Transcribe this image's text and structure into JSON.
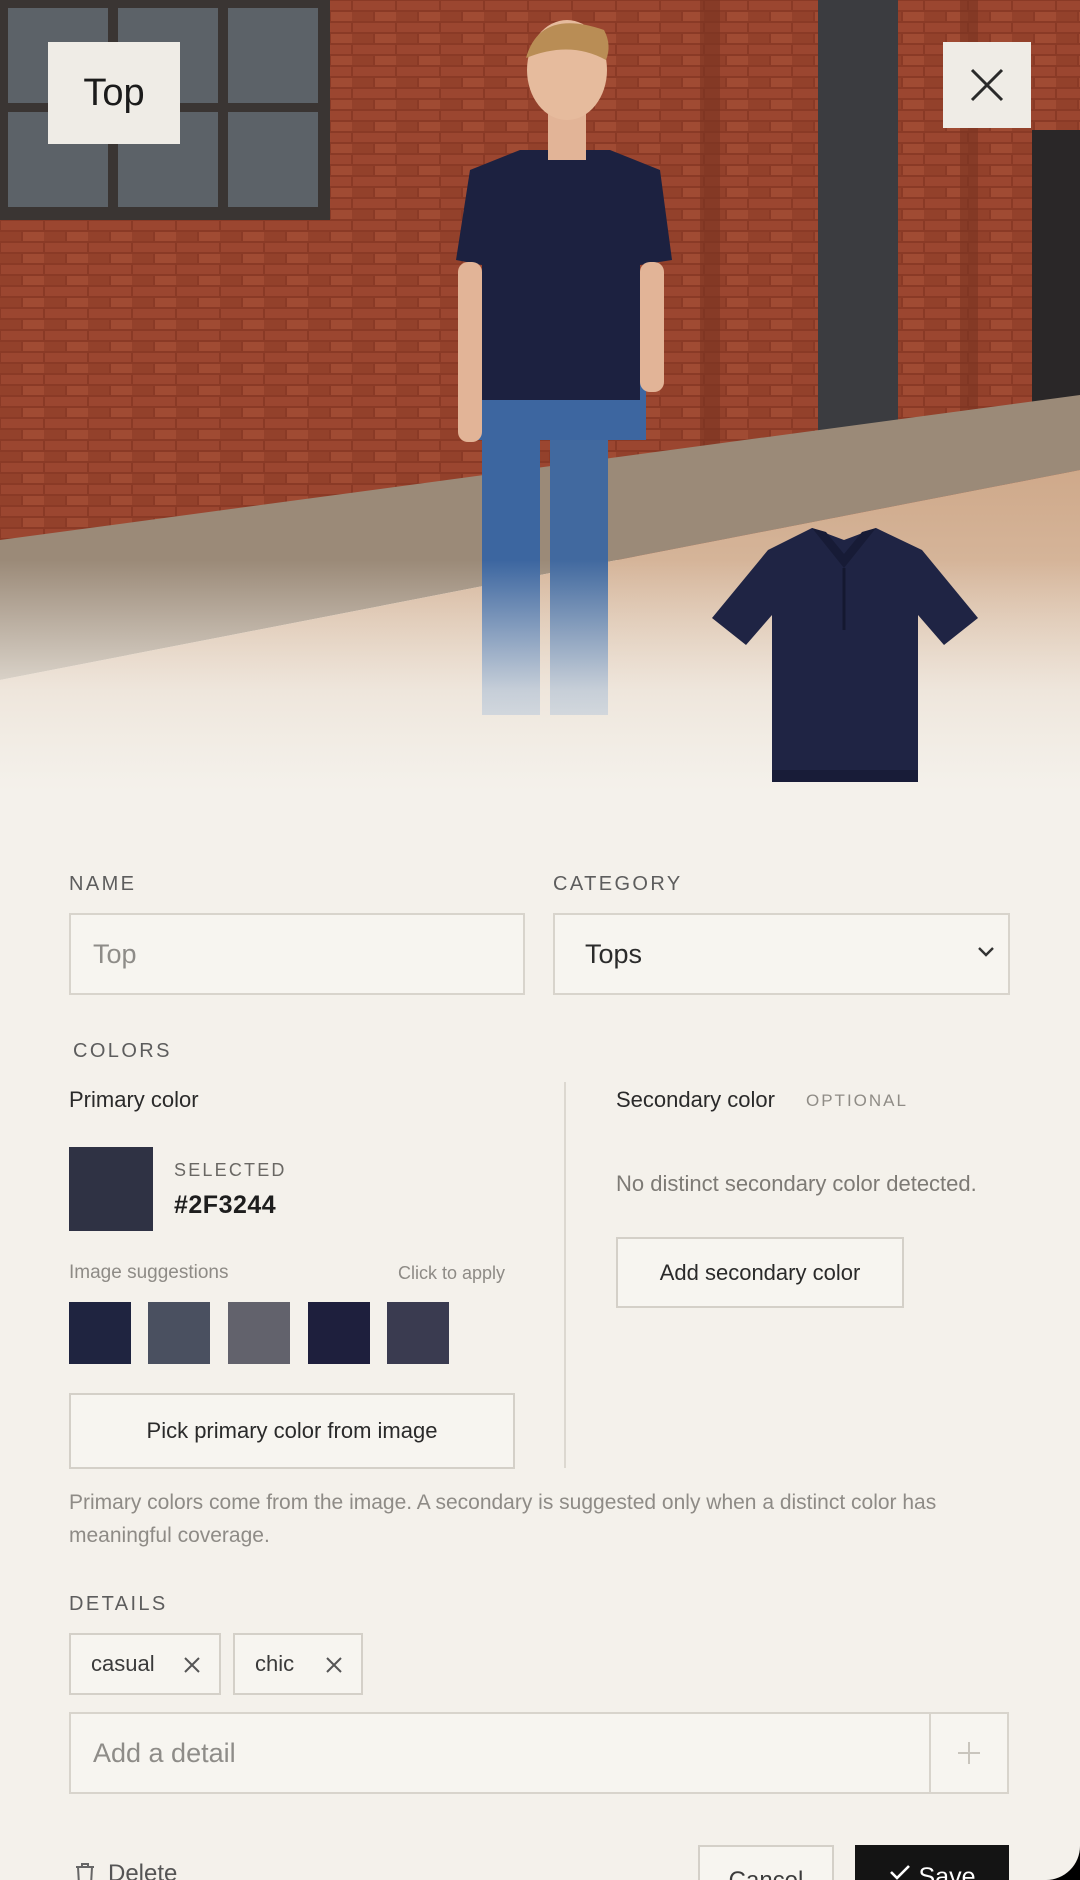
{
  "header": {
    "badge_label": "Top"
  },
  "icons": {
    "close": "close-icon",
    "chevron": "chevron-down-icon",
    "remove": "x-icon",
    "add": "plus-icon",
    "delete": "trash-icon",
    "save": "check-icon"
  },
  "form": {
    "name_label": "NAME",
    "name_placeholder": "Top",
    "category_label": "CATEGORY",
    "category_value": "Tops"
  },
  "colors": {
    "section_label": "COLORS",
    "primary_title": "Primary color",
    "selected_label": "SELECTED",
    "selected_hex": "#2F3244",
    "suggestions_label": "Image suggestions",
    "click_to_apply": "Click to apply",
    "suggestions": [
      "#1f2440",
      "#4a5060",
      "#62626c",
      "#1e1f3d",
      "#3a3b50"
    ],
    "pick_button": "Pick primary color from image",
    "secondary_title": "Secondary color",
    "optional_label": "OPTIONAL",
    "no_secondary_text": "No distinct secondary color detected.",
    "add_secondary_button": "Add secondary color",
    "help_text": "Primary colors come from the image. A secondary is suggested only when a distinct color has meaningful coverage."
  },
  "details": {
    "section_label": "DETAILS",
    "tags": [
      "casual",
      "chic"
    ],
    "input_placeholder": "Add a detail"
  },
  "footer": {
    "delete_label": "Delete",
    "cancel_label": "Cancel",
    "save_label": "Save"
  }
}
